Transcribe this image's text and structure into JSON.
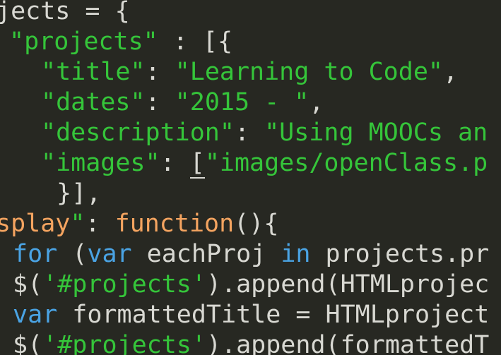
{
  "code": {
    "lines": [
      [
        {
          "text": "jects = {",
          "cls": "tok-plain"
        }
      ],
      [
        {
          "text": "\"projects\"",
          "cls": "tok-str"
        },
        {
          "text": " : [{",
          "cls": "tok-plain"
        }
      ],
      [
        {
          "text": "\"title\"",
          "cls": "tok-str"
        },
        {
          "text": ": ",
          "cls": "tok-plain"
        },
        {
          "text": "\"Learning to Code\"",
          "cls": "tok-str"
        },
        {
          "text": ",",
          "cls": "tok-plain"
        }
      ],
      [
        {
          "text": "\"dates\"",
          "cls": "tok-str"
        },
        {
          "text": ": ",
          "cls": "tok-plain"
        },
        {
          "text": "\"2015 - \"",
          "cls": "tok-str"
        },
        {
          "text": ",",
          "cls": "tok-plain"
        }
      ],
      [
        {
          "text": "\"description\"",
          "cls": "tok-str"
        },
        {
          "text": ": ",
          "cls": "tok-plain"
        },
        {
          "text": "\"Using MOOCs an",
          "cls": "tok-str"
        }
      ],
      [
        {
          "text": "\"images\"",
          "cls": "tok-str"
        },
        {
          "text": ": ",
          "cls": "tok-plain"
        },
        {
          "text": "[",
          "cls": "tok-plain underline"
        },
        {
          "text": "\"images/openClass.p",
          "cls": "tok-str"
        }
      ],
      [
        {
          "text": "}],",
          "cls": "tok-plain"
        }
      ],
      [
        {
          "text": "splay",
          "cls": "tok-fn"
        },
        {
          "text": "\"",
          "cls": "tok-str"
        },
        {
          "text": ": ",
          "cls": "tok-plain"
        },
        {
          "text": "function",
          "cls": "tok-fn"
        },
        {
          "text": "(){",
          "cls": "tok-plain"
        }
      ],
      [
        {
          "text": "for",
          "cls": "tok-kw"
        },
        {
          "text": " (",
          "cls": "tok-plain"
        },
        {
          "text": "var",
          "cls": "tok-kw"
        },
        {
          "text": " eachProj ",
          "cls": "tok-plain"
        },
        {
          "text": "in",
          "cls": "tok-kw"
        },
        {
          "text": " projects.pr",
          "cls": "tok-plain"
        }
      ],
      [
        {
          "text": "$(",
          "cls": "tok-plain"
        },
        {
          "text": "'#projects'",
          "cls": "tok-str"
        },
        {
          "text": ").append(HTMLprojec",
          "cls": "tok-plain"
        }
      ],
      [
        {
          "text": "var",
          "cls": "tok-kw"
        },
        {
          "text": " formattedTitle = HTMLproject",
          "cls": "tok-plain"
        }
      ],
      [
        {
          "text": "$(",
          "cls": "tok-plain"
        },
        {
          "text": "'#projects'",
          "cls": "tok-str"
        },
        {
          "text": ").append(formattedT",
          "cls": "tok-plain"
        }
      ]
    ]
  }
}
